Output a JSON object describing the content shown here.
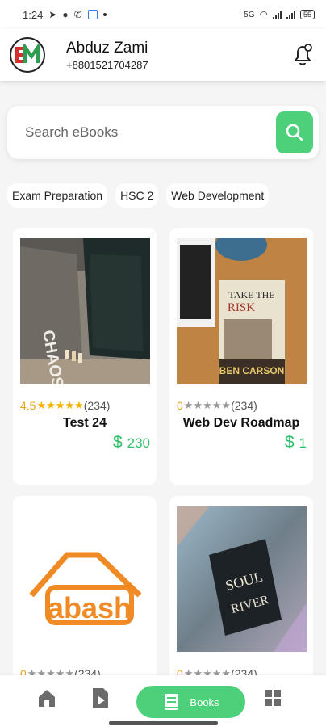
{
  "status_bar": {
    "time": "1:24",
    "battery": "55",
    "network_label": "5G"
  },
  "header": {
    "user_name": "Abduz Zami",
    "phone": "+8801521704287",
    "logo_text": "EM"
  },
  "search": {
    "placeholder": "Search eBooks"
  },
  "categories": [
    "Exam Preparation",
    "HSC 2",
    "Web Development"
  ],
  "books": [
    {
      "rating": "4.5",
      "stars_on": 5,
      "reviews": "(234)",
      "title": "Test 24",
      "currency": "$",
      "price": "230"
    },
    {
      "rating": "0",
      "stars_on": 0,
      "reviews": "(234)",
      "title": "Web Dev Roadmap",
      "currency": "$",
      "price": "1"
    },
    {
      "rating": "0",
      "stars_on": 0,
      "reviews": "(234)",
      "title": "",
      "currency": "",
      "price": ""
    },
    {
      "rating": "0",
      "stars_on": 0,
      "reviews": "(234)",
      "title": "",
      "currency": "",
      "price": ""
    }
  ],
  "covers": {
    "book2_line1": "TAKE THE",
    "book2_line2": "RISK",
    "book2_author": "BEN CARSON",
    "book3_brand": "abash",
    "book4_line1": "SOUL",
    "book4_line2": "RIVER",
    "book1_spine": "CHAOS"
  },
  "bottom_nav": {
    "books_label": "Books"
  },
  "colors": {
    "accent": "#4cd07a",
    "price": "#2ec16a",
    "star": "#f5b400"
  }
}
